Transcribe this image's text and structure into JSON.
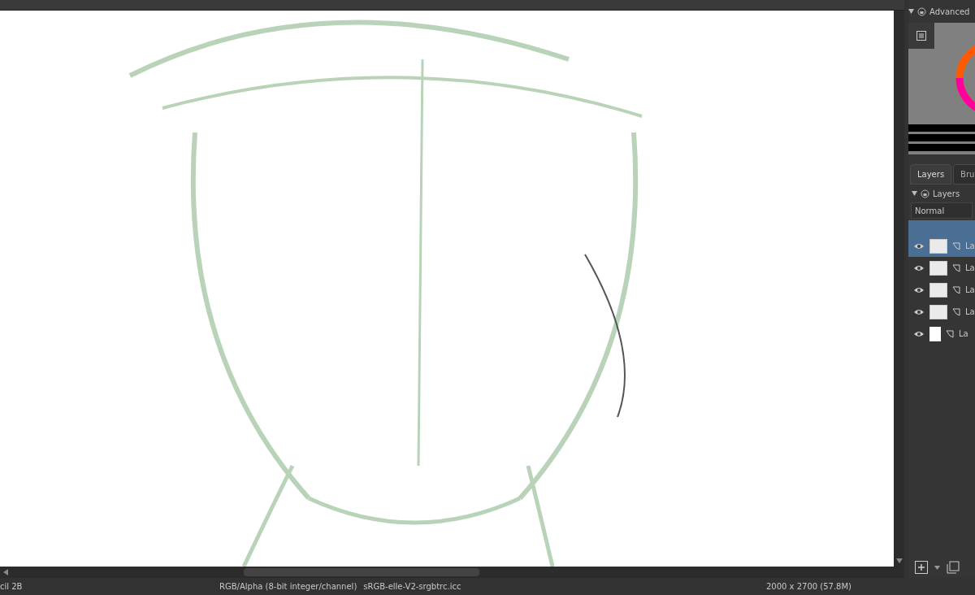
{
  "color_docker": {
    "title": "Advanced"
  },
  "tabs": [
    {
      "label": "Layers",
      "selected": true
    },
    {
      "label": "Bru",
      "selected": false
    }
  ],
  "layers_docker": {
    "title": "Layers",
    "blend_mode": "Normal"
  },
  "layers": [
    {
      "name": "La",
      "selected": true,
      "visible": true,
      "kind": "transparent"
    },
    {
      "name": "La",
      "selected": false,
      "visible": true,
      "kind": "transparent"
    },
    {
      "name": "La",
      "selected": false,
      "visible": true,
      "kind": "transparent"
    },
    {
      "name": "La",
      "selected": false,
      "visible": true,
      "kind": "transparent"
    },
    {
      "name": "La",
      "selected": false,
      "visible": true,
      "kind": "white"
    }
  ],
  "status_bar": {
    "tool": "cil 2B",
    "color_model": "RGB/Alpha (8-bit integer/channel)",
    "profile": "sRGB-elle-V2-srgbtrc.icc",
    "size": "2000 x 2700 (57.8M)"
  }
}
